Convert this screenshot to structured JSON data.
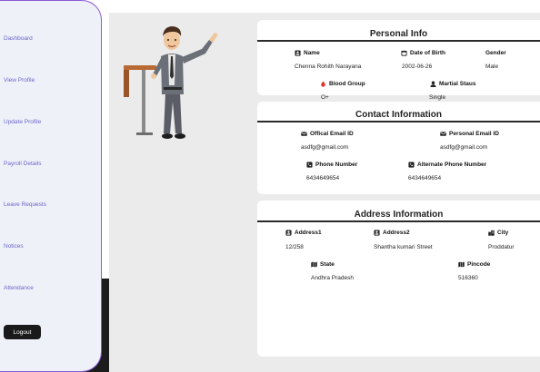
{
  "sidebar": {
    "items": [
      {
        "label": "Dashboard"
      },
      {
        "label": "View Profile"
      },
      {
        "label": "Update Profile"
      },
      {
        "label": "Payroll Details"
      },
      {
        "label": "Leave Requests"
      },
      {
        "label": "Notices"
      },
      {
        "label": "Attendance"
      }
    ],
    "logout_label": "Logout"
  },
  "personal": {
    "title": "Personal Info",
    "name_label": "Name",
    "name_value": "Chenna Rohith Narayana",
    "dob_label": "Date of Birth",
    "dob_value": "2002-06-26",
    "gender_label": "Gender",
    "gender_value": "Male",
    "blood_label": "Blood Group",
    "blood_value": "O+",
    "marital_label": "Martial Staus",
    "marital_value": "Single"
  },
  "contact": {
    "title": "Contact Information",
    "official_email_label": "Offical Email ID",
    "official_email_value": "asdfg@gmail.com",
    "personal_email_label": "Personal Email ID",
    "personal_email_value": "asdfg@gmail.com",
    "phone_label": "Phone Number",
    "phone_value": "6434649654",
    "alt_phone_label": "Alternate Phone Number",
    "alt_phone_value": "6434649654"
  },
  "address": {
    "title": "Address Information",
    "address1_label": "Address1",
    "address1_value": "12/258",
    "address2_label": "Address2",
    "address2_value": "Shantha kumari Street",
    "city_label": "City",
    "city_value": "Proddatur",
    "state_label": "State",
    "state_value": "Andhra Pradesh",
    "pincode_label": "Pincode",
    "pincode_value": "516360"
  },
  "colors": {
    "sidebar_bg": "#eef2f8",
    "sidebar_border": "#8a5cd6",
    "nav_text": "#6c63c9",
    "main_bg": "#ebebeb",
    "blood_icon": "#e0322b"
  }
}
